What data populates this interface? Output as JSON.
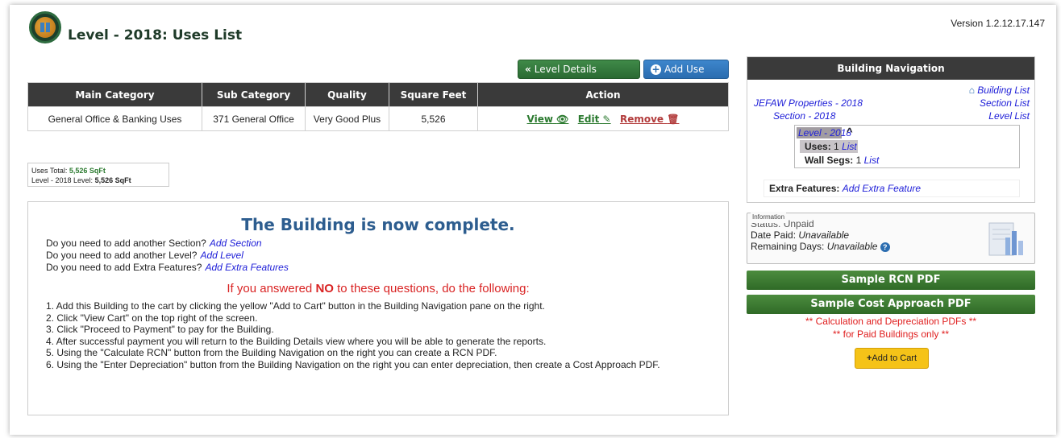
{
  "header": {
    "title": "Level - 2018: Uses List",
    "version": "Version 1.2.12.17.147"
  },
  "toolbar": {
    "level_details_label": "Level Details",
    "add_use_label": "Add Use"
  },
  "table": {
    "headers": [
      "Main Category",
      "Sub Category",
      "Quality",
      "Square Feet",
      "Action"
    ],
    "rows": [
      {
        "main_category": "General Office & Banking Uses",
        "sub_category": "371 General Office",
        "quality": "Very Good Plus",
        "square_feet": "5,526",
        "actions": {
          "view": "View",
          "edit": "Edit",
          "remove": "Remove"
        }
      }
    ]
  },
  "totals": {
    "uses_label": "Uses Total:",
    "uses_value": "5,526 SqFt",
    "level_label": "Level - 2018 Level:",
    "level_value": "5,526 SqFt"
  },
  "complete": {
    "heading": "The Building is now complete.",
    "questions": [
      {
        "text": "Do you need to add another Section?",
        "link": "Add Section"
      },
      {
        "text": "Do you need to add another Level?",
        "link": "Add Level"
      },
      {
        "text": "Do you need to add Extra Features?",
        "link": "Add Extra Features"
      }
    ],
    "warning_pre": "If you answered",
    "warning_bold": "NO",
    "warning_post": "to these questions, do the following:",
    "steps": [
      "1. Add this Building to the cart by clicking the yellow \"Add to Cart\" button in the Building Navigation pane on the right.",
      "2. Click \"View Cart\" on the top right of the screen.",
      "3. Click \"Proceed to Payment\" to pay for the Building.",
      "4. After successful payment you will return to the Building Details view where you will be able to generate the reports.",
      "5. Using the \"Calculate RCN\" button from the Building Navigation on the right you can create a RCN PDF.",
      "6. Using the \"Enter Depreciation\" button from the Building Navigation on the right you can enter depreciation, then create a Cost Approach PDF."
    ]
  },
  "nav": {
    "title": "Building Navigation",
    "building_list": "Building List",
    "property": "JEFAW Properties - 2018",
    "section_list": "Section List",
    "section": "Section - 2018",
    "level_list": "Level List",
    "level": "Level - 2018",
    "uses_label": "Uses:",
    "uses_count": "1",
    "uses_list": "List",
    "wall_label": "Wall Segs:",
    "wall_count": "1",
    "wall_list": "List",
    "extra_label": "Extra Features:",
    "extra_link": "Add Extra Feature"
  },
  "info": {
    "legend": "Information",
    "status": "Status: Unpaid",
    "date_label": "Date Paid:",
    "date_value": "Unavailable",
    "remaining_label": "Remaining Days:",
    "remaining_value": "Unavailable"
  },
  "actions": {
    "sample_rcn": "Sample RCN PDF",
    "sample_cost": "Sample Cost Approach PDF",
    "note1": "** Calculation and Depreciation PDFs **",
    "note2": "** for Paid Buildings only **",
    "add_to_cart": "Add to Cart"
  },
  "colors": {
    "accent_green": "#2b7a2f",
    "accent_blue": "#2b6db0",
    "warning_red": "#d92323",
    "header_dark": "#3a3a3a",
    "cart_yellow": "#f5c318"
  }
}
